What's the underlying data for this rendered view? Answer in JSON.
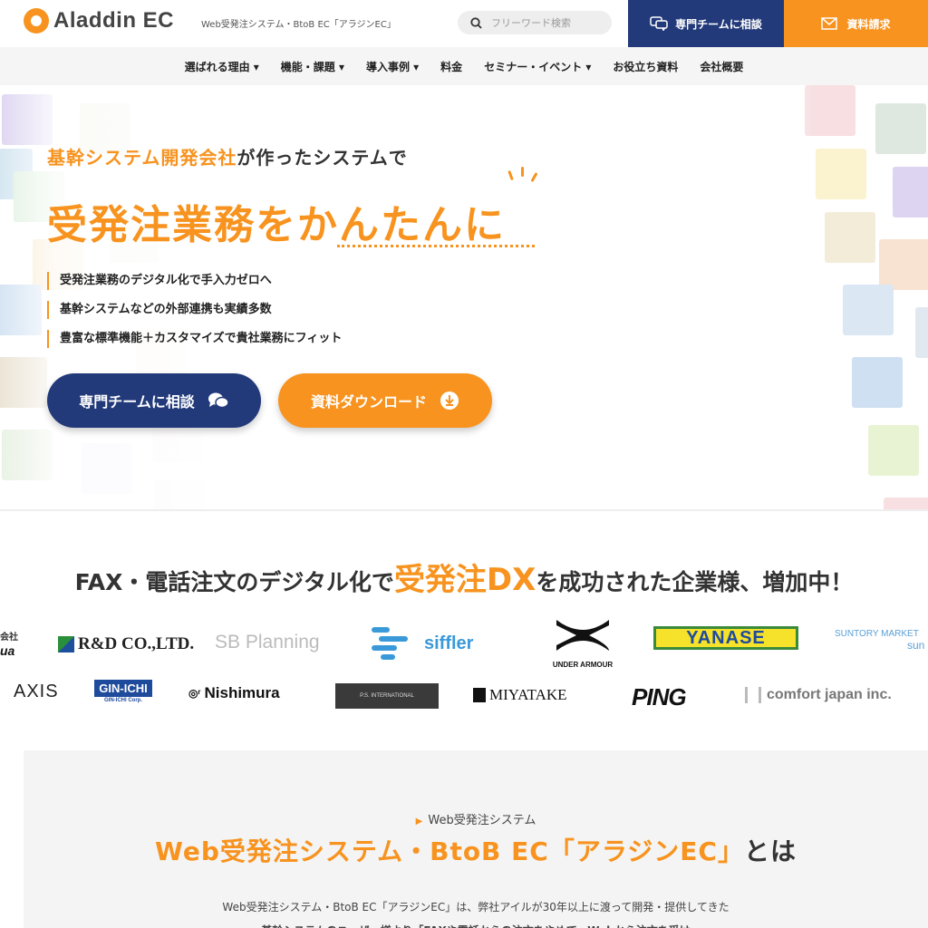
{
  "header": {
    "logo_text": "Aladdin EC",
    "tagline": "Web受発注システム・BtoB EC「アラジンEC」",
    "search_placeholder": "フリーワード検索",
    "consult_button": "専門チームに相談",
    "request_button": "資料請求"
  },
  "nav": {
    "items": [
      {
        "label": "選ばれる理由 ▾"
      },
      {
        "label": "機能・課題 ▾"
      },
      {
        "label": "導入事例 ▾"
      },
      {
        "label": "料金"
      },
      {
        "label": "セミナー・イベント ▾"
      },
      {
        "label": "お役立ち資料"
      },
      {
        "label": "会社概要"
      }
    ]
  },
  "hero": {
    "sub_highlight": "基幹システム開発会社",
    "sub_rest": "が作ったシステムで",
    "main": "受発注業務をかんたんに",
    "points": [
      "受発注業務のデジタル化で手入力ゼロへ",
      "基幹システムなどの外部連携も実績多数",
      "豊富な標準機能＋カスタマイズで貴社業務にフィット"
    ],
    "cta_consult": "専門チームに相談",
    "cta_download": "資料ダウンロード"
  },
  "clients": {
    "title_pre": "FAX・電話注文のデジタル化で",
    "title_big": "受発注DX",
    "title_post": "を成功された企業様、増加中！",
    "row1": [
      "R&D CO.,LTD.",
      "SB Planning",
      "siffler",
      "UNDER ARMOUR",
      "YANASE",
      "SUNTORY MARKET"
    ],
    "row2": [
      "AXIS",
      "GIN-ICHI",
      "Nishimura",
      "P.S. INTERNATIONAL",
      "MIYATAKE",
      "PING",
      "comfort japan inc."
    ],
    "partial_left_top": "会社",
    "partial_left_bottom": "ua",
    "suntory_sub": "sun",
    "ginichi_sub": "GIN-ICHI Corp."
  },
  "about": {
    "eyebrow": "Web受発注システム",
    "title_orange": "Web受発注システム・BtoB EC「アラジンEC」",
    "title_dark": "とは",
    "body_line1": "Web受発注システム・BtoB EC「アラジンEC」は、弊社アイルが30年以上に渡って開発・提供してきた",
    "body_line2": "基幹システムのユーザー様より「FAXや電話からの注文をやめて、Webから注文を受け"
  },
  "colors": {
    "accent": "#f7931e",
    "navy": "#233a7a"
  }
}
